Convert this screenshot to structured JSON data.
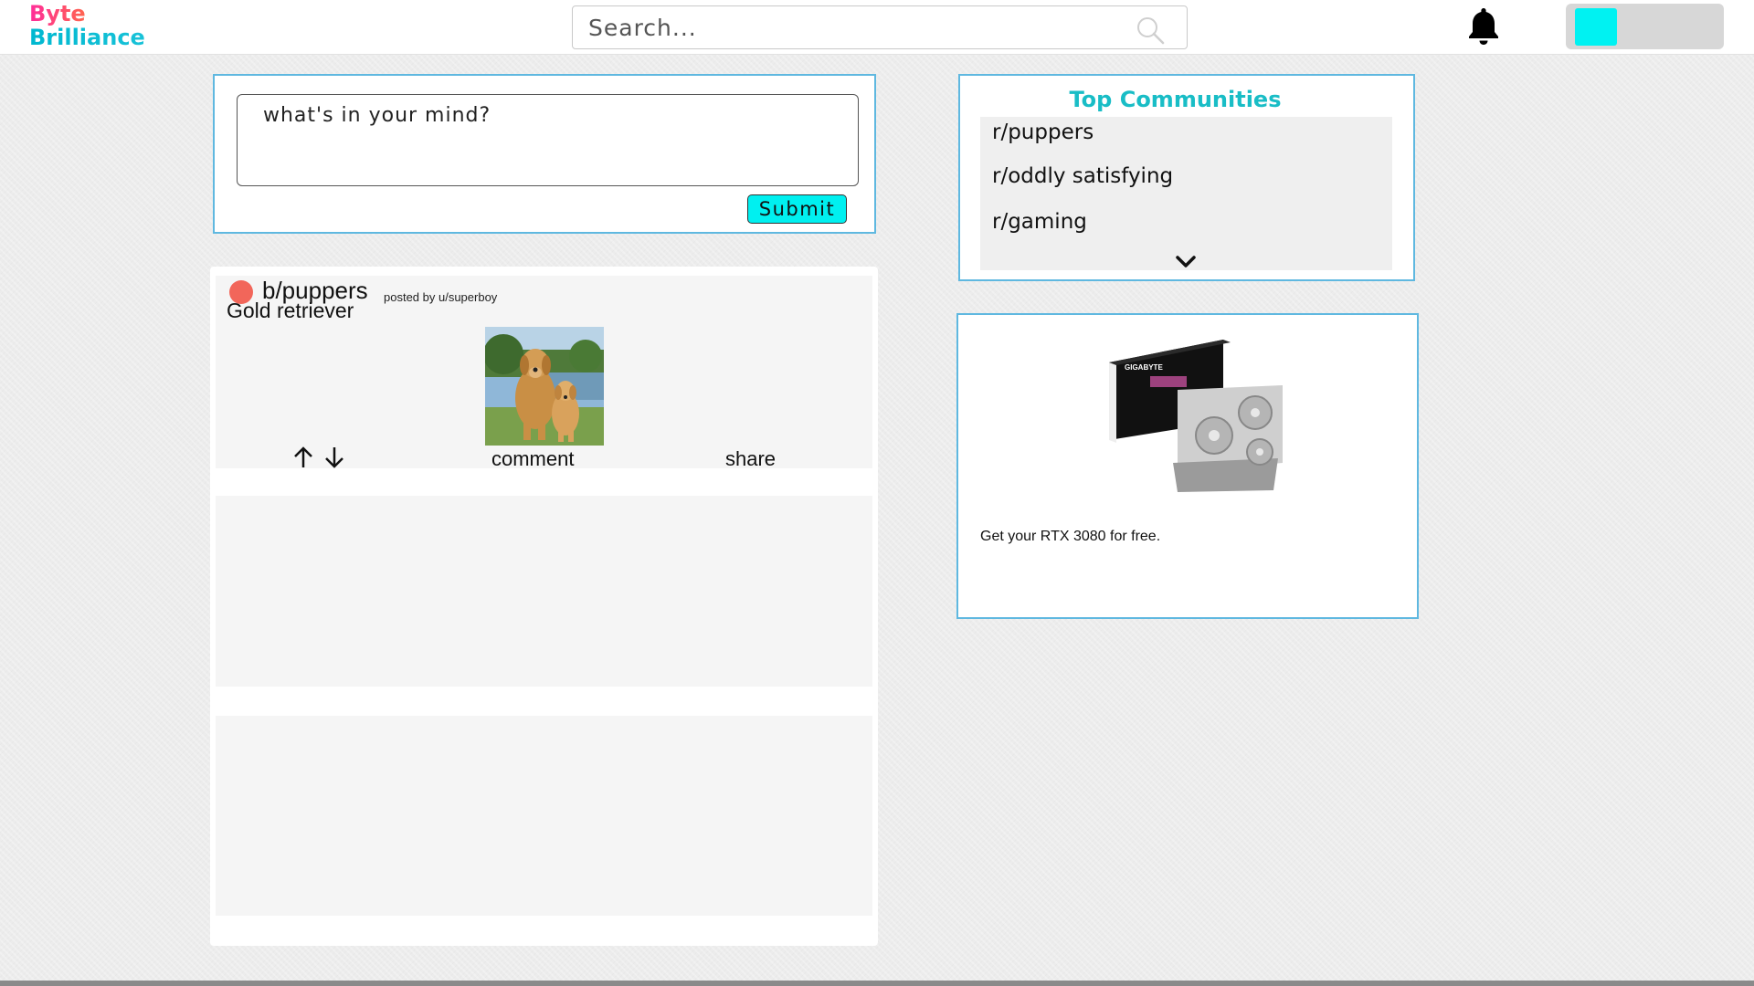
{
  "header": {
    "logo_line1": "Byte",
    "logo_line2": "Brilliance",
    "search_placeholder": "Search..."
  },
  "compose": {
    "placeholder": "what's in your mind?",
    "submit_label": "Submit"
  },
  "feed": {
    "posts": [
      {
        "community": "b/puppers",
        "meta": "posted by u/superboy",
        "title": "Gold retriever",
        "comment_label": "comment",
        "share_label": "share"
      }
    ]
  },
  "communities": {
    "title": "Top Communities",
    "items": [
      "r/puppers",
      "r/oddly satisfying",
      "r/gaming"
    ]
  },
  "ad": {
    "text": "Get your RTX 3080 for free.",
    "brand_text": "GIGABYTE",
    "product_text": "RTX"
  },
  "colors": {
    "accent_cyan": "#00f0f0",
    "border_blue": "#5fb8e0",
    "title_teal": "#19bdc6",
    "dot_red": "#f2665a"
  }
}
